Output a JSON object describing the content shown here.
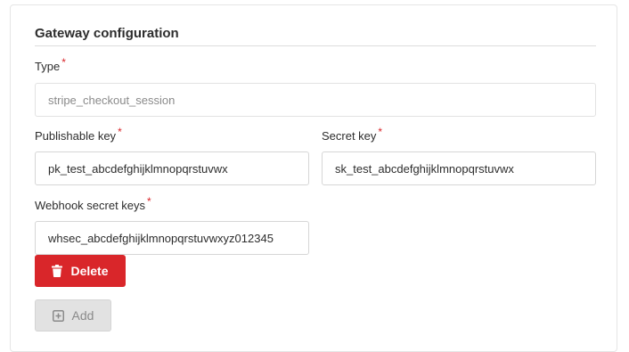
{
  "section": {
    "title": "Gateway configuration"
  },
  "fields": {
    "type": {
      "label": "Type",
      "required_mark": "*",
      "placeholder": "stripe_checkout_session"
    },
    "publishable_key": {
      "label": "Publishable key",
      "required_mark": "*",
      "value": "pk_test_abcdefghijklmnopqrstuvwx"
    },
    "secret_key": {
      "label": "Secret key",
      "required_mark": "*",
      "value": "sk_test_abcdefghijklmnopqrstuvwx"
    },
    "webhook_secret_keys": {
      "label": "Webhook secret keys",
      "required_mark": "*",
      "value": "whsec_abcdefghijklmnopqrstuvwxyz012345"
    }
  },
  "buttons": {
    "delete_label": "Delete",
    "add_label": "Add",
    "delete_icon": "trash-icon",
    "add_icon": "plus-square-icon"
  },
  "colors": {
    "danger": "#d9262a",
    "required": "#d9262a",
    "disabled_bg": "#e2e2e2"
  }
}
